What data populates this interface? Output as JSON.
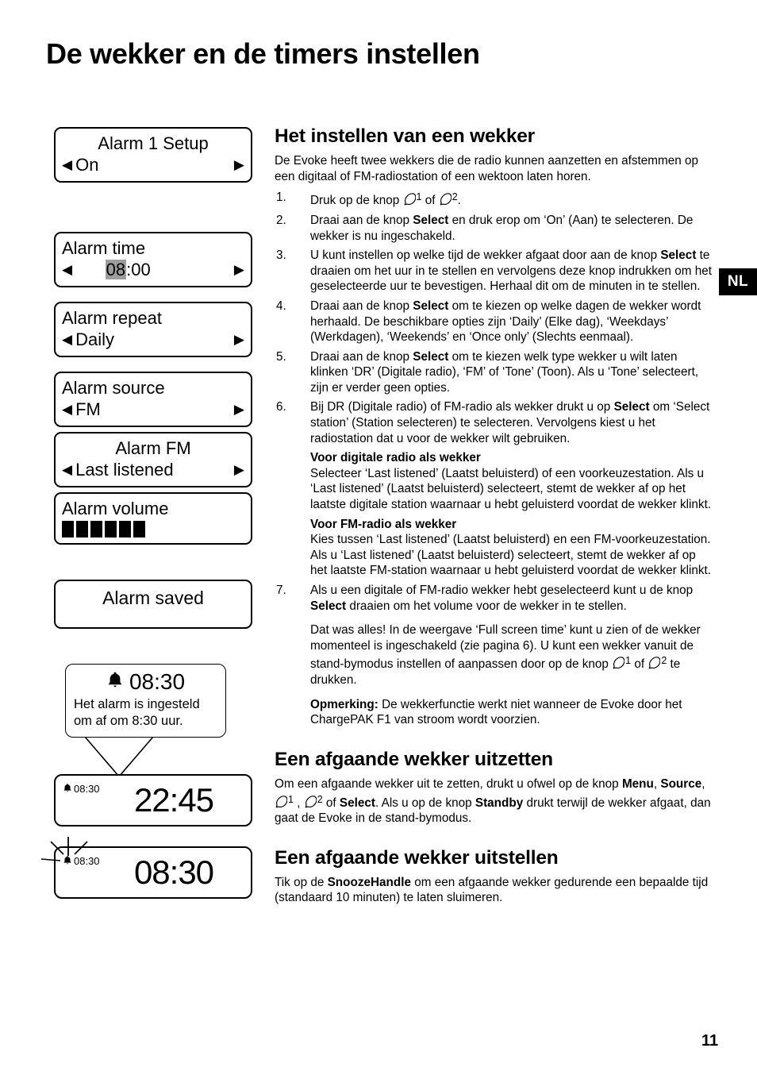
{
  "page": {
    "title": "De wekker en de timers instellen",
    "language_tab": "NL",
    "page_number": "11"
  },
  "screens": [
    {
      "name": "alarm-1-setup",
      "title": "Alarm 1 Setup",
      "value": "On",
      "left_arrow": "◀",
      "right_arrow": "▶"
    },
    {
      "name": "alarm-time",
      "title": "Alarm time",
      "value_highlight": "08",
      "value_rest": ":00",
      "left_arrow": "◀",
      "right_arrow": "▶"
    },
    {
      "name": "alarm-repeat",
      "title": "Alarm repeat",
      "value": "Daily",
      "left_arrow": "◀",
      "right_arrow": "▶"
    },
    {
      "name": "alarm-source",
      "title": "Alarm source",
      "value": "FM",
      "left_arrow": "◀",
      "right_arrow": "▶"
    },
    {
      "name": "alarm-fm",
      "title": "Alarm FM",
      "value": "Last listened",
      "left_arrow": "◀",
      "right_arrow": "▶"
    },
    {
      "name": "alarm-volume",
      "title": "Alarm volume",
      "volume_blocks": 6
    },
    {
      "name": "alarm-saved",
      "title": "Alarm saved"
    }
  ],
  "callout": {
    "time": "08:30",
    "text_line1": "Het alarm is ingesteld",
    "text_line2": "om af om 8:30 uur."
  },
  "clock_standby": {
    "mini_time": "08:30",
    "big_time": "22:45"
  },
  "clock_ringing": {
    "mini_time": "08:30",
    "big_time": "08:30"
  },
  "article": {
    "heading1": "Het instellen van een wekker",
    "intro": "De Evoke heeft twee wekkers die de radio kunnen aanzetten en afstemmen op een digitaal of FM-radiostation of een wektoon laten horen.",
    "steps": {
      "s1_a": "Druk op de knop ",
      "s1_of": " of ",
      "s1_end": ".",
      "s2_a": "Draai aan de knop ",
      "s2_b": "Select",
      "s2_c": " en druk erop om ‘On’ (Aan) te selecteren. De wekker is nu ingeschakeld.",
      "s3_a": "U kunt instellen op welke tijd de wekker afgaat door aan de knop ",
      "s3_b": "Select",
      "s3_c": " te draaien om het uur in te stellen en vervolgens deze knop indrukken om het geselecteerde uur te bevestigen. Herhaal dit om de minuten in te stellen.",
      "s4_a": "Draai aan de knop ",
      "s4_b": "Select",
      "s4_c": " om te kiezen op welke dagen de wekker wordt herhaald. De beschikbare opties zijn ‘Daily’ (Elke dag), ‘Weekdays’ (Werkdagen), ‘Weekends’ en ‘Once only’ (Slechts eenmaal).",
      "s5_a": "Draai aan de knop ",
      "s5_b": "Select",
      "s5_c": " om te kiezen welk type wekker u wilt laten klinken ‘DR’ (Digitale radio), ‘FM’ of ‘Tone’ (Toon). Als u ‘Tone’ selecteert, zijn er verder geen opties.",
      "s6_a": "Bij DR (Digitale radio) of FM-radio als wekker drukt u op ",
      "s6_b": "Select",
      "s6_c": " om ‘Select station’ (Station selecteren) te selecteren. Vervolgens kiest u het radiostation dat u voor de wekker wilt gebruiken.",
      "s7_a": "Als u een digitale of FM-radio wekker hebt geselecteerd kunt u de knop ",
      "s7_b": "Select",
      "s7_c": " draaien om het volume voor de wekker in te stellen."
    },
    "sub_dr_heading": "Voor digitale radio als wekker",
    "sub_dr_body": "Selecteer ‘Last listened’ (Laatst beluisterd) of een voorkeuzestation. Als u ‘Last listened’ (Laatst beluisterd) selecteert, stemt de wekker af op het laatste digitale station waarnaar u hebt geluisterd voordat de wekker klinkt.",
    "sub_fm_heading": "Voor FM-radio als wekker",
    "sub_fm_body": "Kies tussen ‘Last listened’ (Laatst beluisterd) en een FM-voorkeuzestation. Als u ‘Last listened’ (Laatst beluisterd) selecteert, stemt de wekker af op het laatste FM-station waarnaar u hebt geluisterd voordat de wekker klinkt.",
    "closing_a": "Dat was alles! In de weergave ‘Full screen time’ kunt u zien of de wekker momenteel is ingeschakeld (zie pagina 6). U kunt een wekker vanuit de stand-bymodus instellen of aanpassen door op de knop ",
    "closing_of": " of ",
    "closing_b": " te drukken.",
    "note_label": "Opmerking:",
    "note_body": " De wekkerfunctie werkt niet wanneer de Evoke door het ChargePAK F1 van stroom wordt voorzien.",
    "heading2": "Een afgaande wekker uitzetten",
    "section2_a": "Om een afgaande wekker uit te zetten, drukt u ofwel op de knop ",
    "section2_menu": "Menu",
    "section2_comma1": ", ",
    "section2_source": "Source",
    "section2_comma2": ", ",
    "section2_comma3": " , ",
    "section2_of": " of ",
    "section2_select": "Select",
    "section2_b": ". Als u op de knop ",
    "section2_standby": "Standby",
    "section2_c": " drukt terwijl de wekker afgaat, dan gaat de Evoke in de stand-bymodus.",
    "heading3": "Een afgaande wekker uitstellen",
    "section3_a": "Tik op de ",
    "section3_b": "SnoozeHandle",
    "section3_c": " om een afgaande wekker gedurende een bepaalde tijd (standaard 10 minuten) te laten sluimeren."
  },
  "icons": {
    "bell_button": "alarm-bell-button-icon",
    "bell_solid": "alarm-bell-icon",
    "arrow_left": "arrow-left-icon",
    "arrow_right": "arrow-right-icon"
  },
  "superscripts": {
    "one": "1",
    "two": "2"
  }
}
